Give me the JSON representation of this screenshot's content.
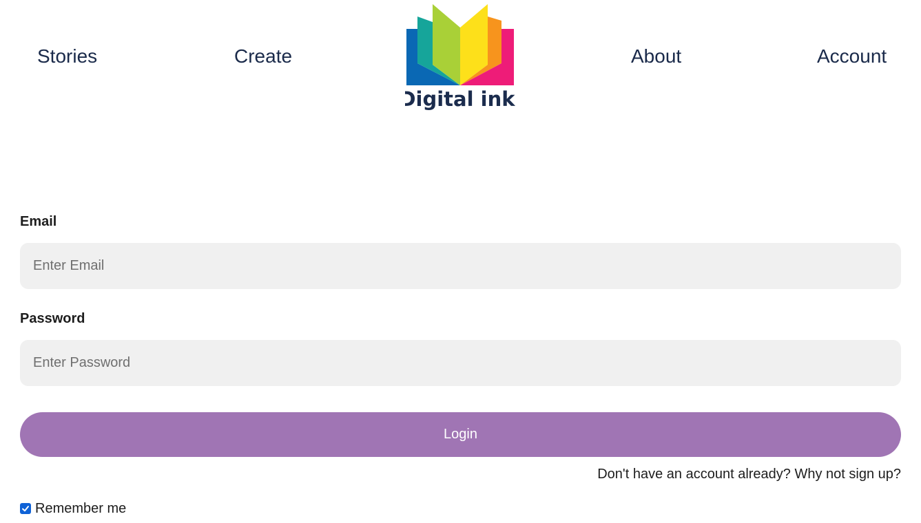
{
  "nav": {
    "links": [
      "Stories",
      "Create",
      "About",
      "Account"
    ],
    "logo_text": "Digital ink."
  },
  "form": {
    "email_label": "Email",
    "email_placeholder": "Enter Email",
    "email_value": "",
    "password_label": "Password",
    "password_placeholder": "Enter Password",
    "password_value": "",
    "login_label": "Login",
    "signup_text": "Don't have an account already? Why not sign up?",
    "remember_label": "Remember me",
    "remember_checked": true
  },
  "colors": {
    "login_button": "#a075b4",
    "input_background": "#f0f0f0",
    "nav_text": "#1a2a4a",
    "checkbox": "#0f62d6"
  },
  "icons": {
    "logo": "open-book-logo",
    "checkbox": "check-icon"
  }
}
